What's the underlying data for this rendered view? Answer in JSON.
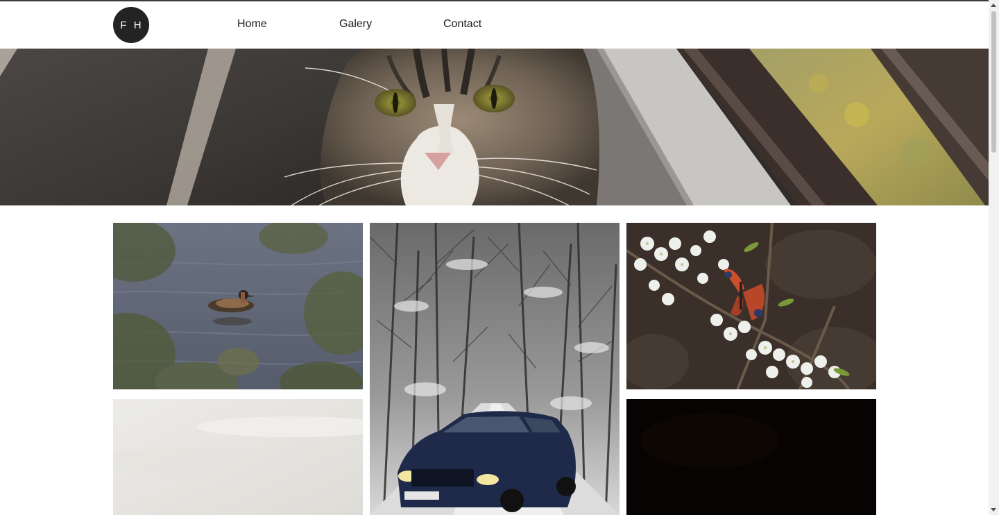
{
  "logo": {
    "text": "F H"
  },
  "nav": {
    "items": [
      {
        "label": "Home"
      },
      {
        "label": "Galery"
      },
      {
        "label": "Contact"
      }
    ]
  },
  "hero": {
    "image": "cat-closeup-photo"
  },
  "gallery": {
    "items": [
      {
        "image": "grebe-on-water-photo"
      },
      {
        "image": "snowy-forest-road-car-photo"
      },
      {
        "image": "butterfly-on-blossom-photo"
      },
      {
        "image": "pale-sky-photo"
      },
      {
        "image": "dark-night-photo"
      }
    ]
  },
  "colors": {
    "logo_bg": "#232323",
    "nav_text": "#1b1b1b",
    "background": "#ffffff"
  }
}
